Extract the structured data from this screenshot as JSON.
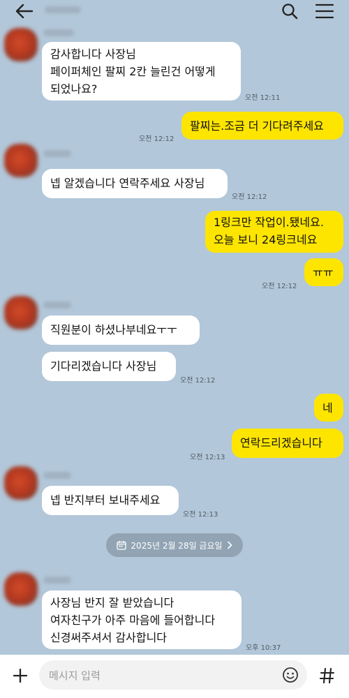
{
  "header": {
    "back_icon": "arrow-left-icon",
    "search_icon": "search-icon",
    "menu_icon": "hamburger-menu-icon"
  },
  "messages": [
    {
      "from": "them",
      "lines": [
        "감사합니다 사장님",
        "페이퍼체인 팔찌 2칸 늘린건 어떻게",
        "되었나요?"
      ],
      "time": "오전 12:11"
    },
    {
      "from": "me",
      "lines": [
        "팔찌는.조금 더 기다려주세요"
      ],
      "time": "오전 12:12"
    },
    {
      "from": "them",
      "lines": [
        "넵 알겠습니다 연락주세요 사장님"
      ],
      "time": "오전 12:12"
    },
    {
      "from": "me",
      "lines": [
        "1링크만 작업이.됐네요.",
        "오늘 보니 24링크네요"
      ],
      "time": ""
    },
    {
      "from": "me",
      "lines": [
        "ㅠㅠ"
      ],
      "time": "오전 12:12"
    },
    {
      "from": "them",
      "lines": [
        "직원분이 하셨나부네요ㅜㅜ"
      ],
      "time": ""
    },
    {
      "from": "them",
      "lines": [
        "기다리겠습니다 사장님"
      ],
      "time": "오전 12:12"
    },
    {
      "from": "me",
      "lines": [
        "네"
      ],
      "time": ""
    },
    {
      "from": "me",
      "lines": [
        "연락드리겠습니다"
      ],
      "time": "오전 12:13"
    },
    {
      "from": "them",
      "lines": [
        "넵 반지부터 보내주세요"
      ],
      "time": "오전 12:13"
    },
    {
      "from": "them",
      "lines": [
        "사장님 반지 잘 받았습니다",
        "여자친구가 아주 마음에 들어합니다",
        "신경써주셔서 감사합니다"
      ],
      "time": "오후 10:37"
    }
  ],
  "date_divider": {
    "text": "2025년 2월 28일 금요일",
    "icon": "calendar-icon",
    "chevron": "chevron-right-icon"
  },
  "composer": {
    "placeholder": "메시지 입력",
    "add_icon": "plus-icon",
    "emoji_icon": "emoji-icon",
    "hash_icon": "hash-icon"
  },
  "colors": {
    "background": "#b2c7d9",
    "my_bubble": "#fee500",
    "their_bubble": "#ffffff"
  }
}
